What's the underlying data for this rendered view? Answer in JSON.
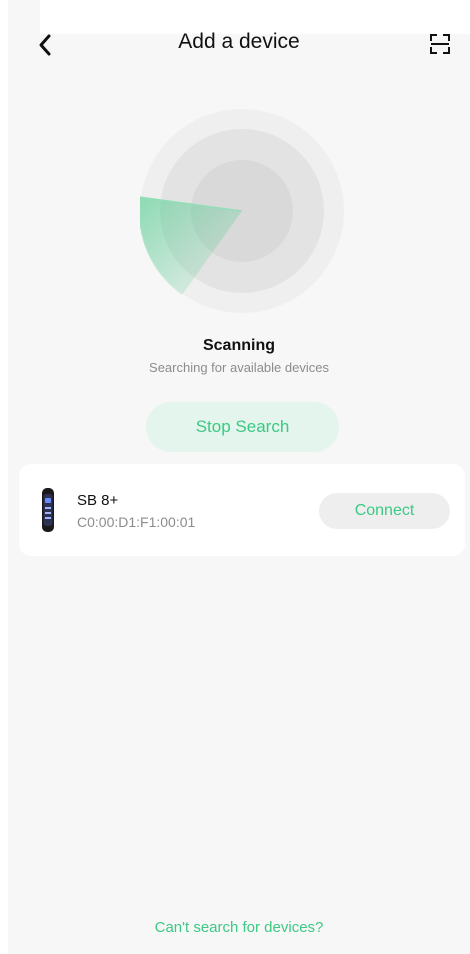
{
  "header": {
    "title": "Add a device",
    "back_icon": "chevron-left-icon",
    "scan_icon": "scan-frame-icon"
  },
  "scan": {
    "status_title": "Scanning",
    "status_subtitle": "Searching for available devices",
    "stop_label": "Stop Search"
  },
  "devices": [
    {
      "name": "SB 8+",
      "mac": "C0:00:D1:F1:00:01",
      "icon": "fitness-band-icon",
      "connect_label": "Connect"
    }
  ],
  "footer": {
    "help_link": "Can't search for devices?"
  },
  "colors": {
    "accent": "#3cc983",
    "accent_soft": "#e3f5ec",
    "background": "#f7f7f7",
    "text": "#111111",
    "muted": "#8c8c8c"
  }
}
